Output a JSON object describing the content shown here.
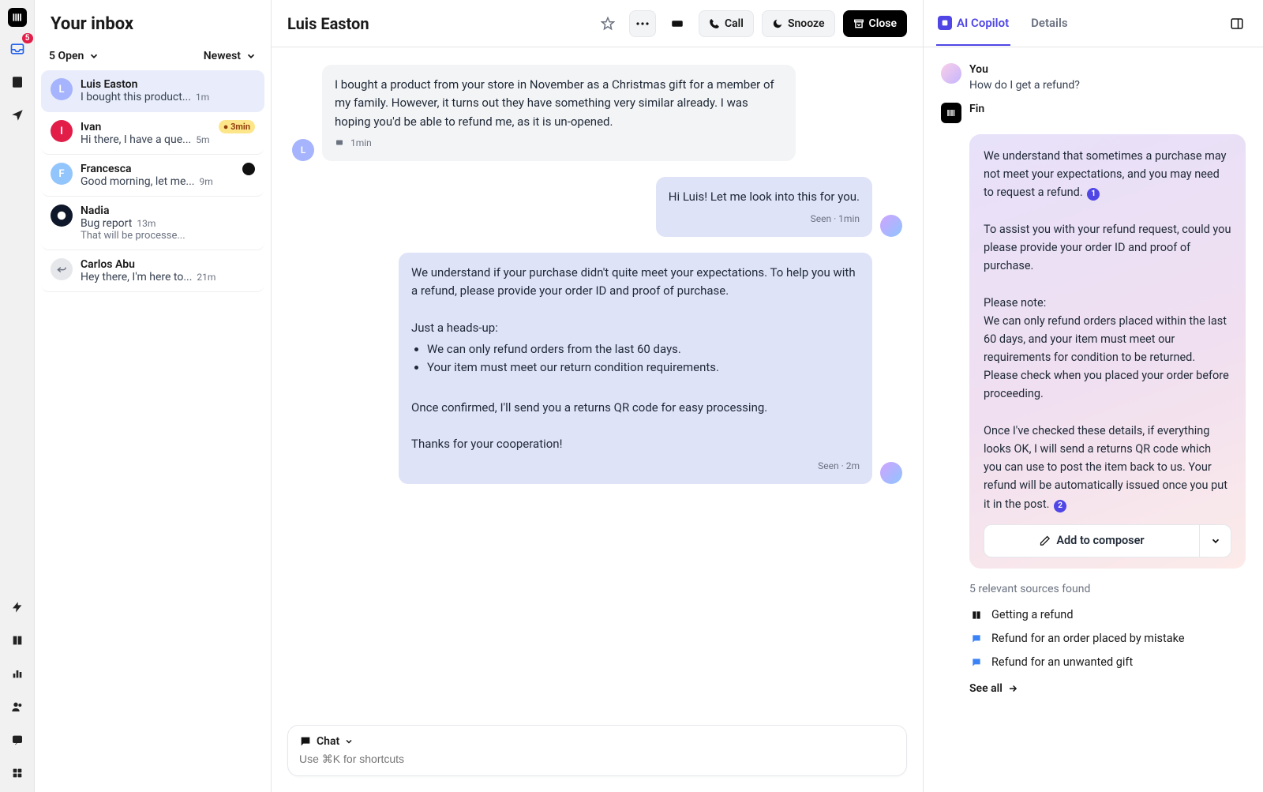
{
  "nav": {
    "notification_count": "5"
  },
  "inbox": {
    "title": "Your inbox",
    "filter_label": "5 Open",
    "sort_label": "Newest",
    "items": [
      {
        "initial": "L",
        "color": "#a5b4fc",
        "name": "Luis Easton",
        "preview": "I bought this product...",
        "time": "1m",
        "selected": true
      },
      {
        "initial": "I",
        "color": "#e11d48",
        "name": "Ivan",
        "preview": "Hi there, I have a que...",
        "time": "5m",
        "chip": "3min"
      },
      {
        "initial": "F",
        "color": "#93c5fd",
        "name": "Francesca",
        "preview": "Good morning, let me...",
        "time": "9m",
        "mini_av": true
      },
      {
        "initial": "",
        "color": "#0f172a",
        "name": "Nadia",
        "preview": "Bug report",
        "sub": "That will be processe...",
        "time": "13m",
        "bug": true
      },
      {
        "initial": "",
        "color": "#e5e7eb",
        "name": "Carlos Abu",
        "preview": "Hey there, I'm here to...",
        "time": "21m",
        "reply": true
      }
    ]
  },
  "convo": {
    "title": "Luis Easton",
    "actions": {
      "call": "Call",
      "snooze": "Snooze",
      "close": "Close"
    },
    "messages": [
      {
        "dir": "in",
        "avatar_initial": "L",
        "text": "I bought a product from your store in November as a Christmas gift for a member of my family. However, it turns out they have something very similar already. I was hoping you'd be able to refund me, as it is un-opened.",
        "meta": "1min"
      },
      {
        "dir": "out",
        "text": "Hi Luis! Let me look into this for you.",
        "meta": "Seen · 1min"
      },
      {
        "dir": "out",
        "html": true,
        "p1": "We understand if your purchase didn't quite meet your expectations. To help you with a refund, please provide your order ID and proof of purchase.",
        "p2": "Just a heads-up:",
        "li1": "We can only refund orders from the last 60 days.",
        "li2": "Your item must meet our return condition requirements.",
        "p3": "Once confirmed, I'll send you a returns QR code for easy processing.",
        "p4": "Thanks for your cooperation!",
        "meta": "Seen ·   2m"
      }
    ],
    "composer": {
      "mode": "Chat",
      "placeholder": "Use ⌘K for shortcuts"
    }
  },
  "rpanel": {
    "tab_copilot": "AI Copilot",
    "tab_details": "Details",
    "you": {
      "name": "You",
      "text": "How do I get a refund?"
    },
    "fin": {
      "name": "Fin",
      "p1": "We understand that sometimes a purchase may not meet your expectations, and you may need to request a refund.",
      "p2": "To assist you with your refund request, could you please provide your order ID and proof of purchase.",
      "p3a": "Please note:",
      "p3b": "We can only refund orders placed within the last 60 days, and your item must meet our requirements for condition to be returned. Please check when you placed your order before proceeding.",
      "p4": "Once I've checked these details, if everything looks OK, I will send a returns QR code which you can use to post the item back to us. Your refund will be automatically issued once you put it in the post.",
      "cite1": "1",
      "cite2": "2",
      "add_label": "Add to composer"
    },
    "sources": {
      "heading": "5 relevant sources found",
      "items": [
        {
          "icon": "book",
          "label": "Getting a refund"
        },
        {
          "icon": "chat",
          "label": "Refund for an order placed by mistake"
        },
        {
          "icon": "chat",
          "label": "Refund for an unwanted gift"
        }
      ],
      "see_all": "See all"
    }
  }
}
